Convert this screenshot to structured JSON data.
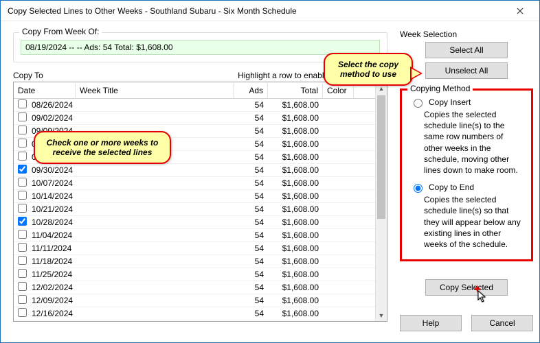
{
  "window": {
    "title": "Copy Selected Lines to Other Weeks - Southland Subaru - Six Month Schedule"
  },
  "copyFrom": {
    "label": "Copy From Week Of:",
    "text": "08/19/2024  --   --  Ads: 54  Total: $1,608.00"
  },
  "copyTo": {
    "label": "Copy To",
    "hint": "Highlight a row to enable match by Week",
    "columns": {
      "date": "Date",
      "title": "Week Title",
      "ads": "Ads",
      "total": "Total",
      "color": "Color"
    },
    "rows": [
      {
        "checked": false,
        "date": "08/26/2024",
        "ads": 54,
        "total": "$1,608.00"
      },
      {
        "checked": false,
        "date": "09/02/2024",
        "ads": 54,
        "total": "$1,608.00"
      },
      {
        "checked": false,
        "date": "09/09/2024",
        "ads": 54,
        "total": "$1,608.00"
      },
      {
        "checked": false,
        "date": "09/16/2024",
        "ads": 54,
        "total": "$1,608.00"
      },
      {
        "checked": false,
        "date": "09/23/2024",
        "ads": 54,
        "total": "$1,608.00"
      },
      {
        "checked": true,
        "date": "09/30/2024",
        "ads": 54,
        "total": "$1,608.00"
      },
      {
        "checked": false,
        "date": "10/07/2024",
        "ads": 54,
        "total": "$1,608.00"
      },
      {
        "checked": false,
        "date": "10/14/2024",
        "ads": 54,
        "total": "$1,608.00"
      },
      {
        "checked": false,
        "date": "10/21/2024",
        "ads": 54,
        "total": "$1,608.00"
      },
      {
        "checked": true,
        "date": "10/28/2024",
        "ads": 54,
        "total": "$1,608.00"
      },
      {
        "checked": false,
        "date": "11/04/2024",
        "ads": 54,
        "total": "$1,608.00"
      },
      {
        "checked": false,
        "date": "11/11/2024",
        "ads": 54,
        "total": "$1,608.00"
      },
      {
        "checked": false,
        "date": "11/18/2024",
        "ads": 54,
        "total": "$1,608.00"
      },
      {
        "checked": false,
        "date": "11/25/2024",
        "ads": 54,
        "total": "$1,608.00"
      },
      {
        "checked": false,
        "date": "12/02/2024",
        "ads": 54,
        "total": "$1,608.00"
      },
      {
        "checked": false,
        "date": "12/09/2024",
        "ads": 54,
        "total": "$1,608.00"
      },
      {
        "checked": false,
        "date": "12/16/2024",
        "ads": 54,
        "total": "$1,608.00"
      }
    ]
  },
  "weekSelection": {
    "label": "Week Selection",
    "selectAll": "Select All",
    "unselectAll": "Unselect All"
  },
  "method": {
    "label": "Copying Method",
    "insert": {
      "label": "Copy Insert",
      "desc": "Copies the selected schedule line(s) to the same row numbers of other weeks in the schedule, moving other lines down to make room."
    },
    "end": {
      "label": "Copy to End",
      "desc": "Copies the selected schedule line(s) so that they will appear below any existing lines in other weeks of the schedule."
    },
    "selected": "end"
  },
  "buttons": {
    "copySelected": "Copy Selected",
    "help": "Help",
    "cancel": "Cancel"
  },
  "callouts": {
    "checkWeeks": "Check one or more weeks to receive the selected lines",
    "selectMethod": "Select the copy method to use"
  }
}
